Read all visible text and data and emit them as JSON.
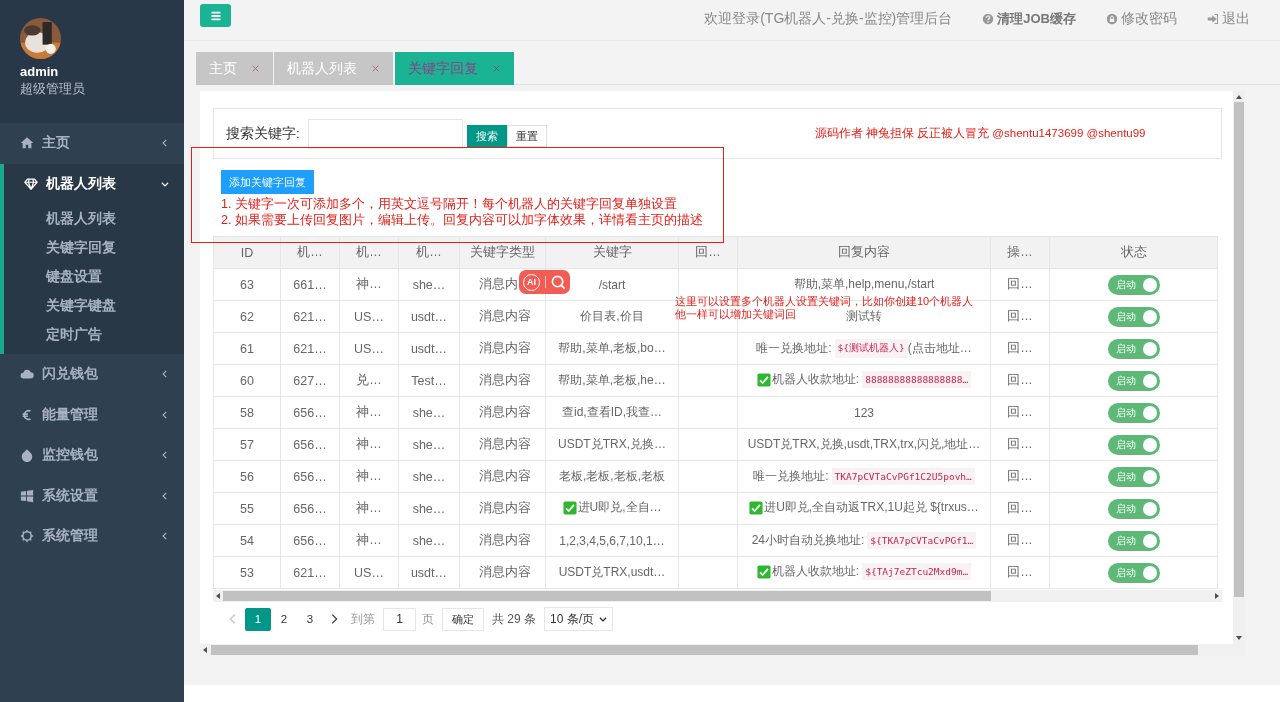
{
  "sidebar": {
    "user": {
      "name": "admin",
      "role": "超级管理员"
    },
    "menu": [
      {
        "label": "主页",
        "expanded": false
      },
      {
        "label": "机器人列表",
        "expanded": true,
        "children": [
          {
            "label": "机器人列表"
          },
          {
            "label": "关键字回复"
          },
          {
            "label": "键盘设置"
          },
          {
            "label": "关键字键盘"
          },
          {
            "label": "定时广告"
          }
        ]
      },
      {
        "label": "闪兑钱包",
        "expanded": false
      },
      {
        "label": "能量管理",
        "expanded": false
      },
      {
        "label": "监控钱包",
        "expanded": false
      },
      {
        "label": "系统设置",
        "expanded": false
      },
      {
        "label": "系统管理",
        "expanded": false
      }
    ]
  },
  "header": {
    "welcome": "欢迎登录(TG机器人-兑换-监控)管理后台",
    "actions": [
      {
        "label": "清理JOB缓存"
      },
      {
        "label": "修改密码"
      },
      {
        "label": "退出"
      }
    ]
  },
  "tabs": [
    {
      "label": "主页",
      "selected": false
    },
    {
      "label": "机器人列表",
      "selected": false
    },
    {
      "label": "关键字回复",
      "selected": true
    }
  ],
  "search": {
    "label": "搜索关键字:",
    "buttons": [
      {
        "label": "搜索",
        "kind": "primary"
      },
      {
        "label": "重置",
        "kind": "plain"
      }
    ],
    "author_note": "源码作者 神兔担保 反正被人冒充 @shentu1473699 @shentu99"
  },
  "add_button": "添加关键字回复",
  "notes": [
    "1. 关键字一次可添加多个，用英文逗号隔开！每个机器人的关键字回复单独设置",
    "2. 如果需要上传回复图片，编辑上传。回复内容可以加字体效果，详情看主页的描述"
  ],
  "table": {
    "columns": [
      "ID",
      "机…",
      "机…",
      "机…",
      "关键字类型",
      "关键字",
      "回…",
      "回复内容",
      "操…",
      "状态"
    ],
    "rows": [
      {
        "id": "63",
        "column_2": "661…",
        "column_3": "神…",
        "column_4": "she…",
        "type": "消息内",
        "keyword": [
          {
            "kind": "text",
            "text": "/start"
          }
        ],
        "reply": [
          {
            "kind": "text",
            "text": "帮助,菜单,help,menu,/start"
          }
        ],
        "column_9": "回…",
        "status": {
          "label": "启动",
          "on": true
        }
      },
      {
        "id": "62",
        "column_2": "621…",
        "column_3": "US…",
        "column_4": "usdt…",
        "type": "消息内容",
        "keyword": [
          {
            "kind": "text",
            "text": "价目表,价目"
          }
        ],
        "reply": [
          {
            "kind": "text",
            "text": "测试转"
          }
        ],
        "column_9": "回…",
        "status": {
          "label": "启动",
          "on": true
        }
      },
      {
        "id": "61",
        "column_2": "621…",
        "column_3": "US…",
        "column_4": "usdt…",
        "type": "消息内容",
        "keyword": [
          {
            "kind": "text",
            "text": "帮助,菜单,老板,bo…"
          }
        ],
        "reply": [
          {
            "kind": "text",
            "text": "唯一兑换地址: "
          },
          {
            "kind": "code",
            "text": "${测试机器人}"
          },
          {
            "kind": "text",
            "text": " (点击地址…"
          }
        ],
        "column_9": "回…",
        "status": {
          "label": "启动",
          "on": true
        }
      },
      {
        "id": "60",
        "column_2": "627…",
        "column_3": "兑…",
        "column_4": "Test…",
        "type": "消息内容",
        "keyword": [
          {
            "kind": "text",
            "text": "帮助,菜单,老板,he…"
          }
        ],
        "reply": [
          {
            "kind": "check"
          },
          {
            "kind": "text",
            "text": "机器人收款地址: "
          },
          {
            "kind": "code",
            "text": "88888888888888888…"
          }
        ],
        "column_9": "回…",
        "status": {
          "label": "启动",
          "on": true
        }
      },
      {
        "id": "58",
        "column_2": "656…",
        "column_3": "神…",
        "column_4": "she…",
        "type": "消息内容",
        "keyword": [
          {
            "kind": "text",
            "text": "查id,查看ID,我查…"
          }
        ],
        "reply": [
          {
            "kind": "text",
            "text": "123"
          }
        ],
        "column_9": "回…",
        "status": {
          "label": "启动",
          "on": true
        }
      },
      {
        "id": "57",
        "column_2": "656…",
        "column_3": "神…",
        "column_4": "she…",
        "type": "消息内容",
        "keyword": [
          {
            "kind": "text",
            "text": "USDT兑TRX,兑换…"
          }
        ],
        "reply": [
          {
            "kind": "text",
            "text": "USDT兑TRX,兑换,usdt,TRX,trx,闪兑,地址…"
          }
        ],
        "column_9": "回…",
        "status": {
          "label": "启动",
          "on": true
        }
      },
      {
        "id": "56",
        "column_2": "656…",
        "column_3": "神…",
        "column_4": "she…",
        "type": "消息内容",
        "keyword": [
          {
            "kind": "text",
            "text": "老板,老板,老板,老板"
          }
        ],
        "reply": [
          {
            "kind": "text",
            "text": "唯一兑换地址: "
          },
          {
            "kind": "code",
            "text": "TKA7pCVTaCvPGf1C2U5povh…"
          }
        ],
        "column_9": "回…",
        "status": {
          "label": "启动",
          "on": true
        }
      },
      {
        "id": "55",
        "column_2": "656…",
        "column_3": "神…",
        "column_4": "she…",
        "type": "消息内容",
        "keyword": [
          {
            "kind": "check"
          },
          {
            "kind": "text",
            "text": "进U即兑,全自…"
          }
        ],
        "reply": [
          {
            "kind": "check"
          },
          {
            "kind": "text",
            "text": "进U即兑,全自动返TRX,1U起兑 ${trxus…"
          }
        ],
        "column_9": "回…",
        "status": {
          "label": "启动",
          "on": true
        }
      },
      {
        "id": "54",
        "column_2": "656…",
        "column_3": "神…",
        "column_4": "she…",
        "type": "消息内容",
        "keyword": [
          {
            "kind": "text",
            "text": "1,2,3,4,5,6,7,10,1…"
          }
        ],
        "reply": [
          {
            "kind": "text",
            "text": "24小时自动兑换地址: "
          },
          {
            "kind": "code",
            "text": "${TKA7pCVTaCvPGf1…"
          }
        ],
        "column_9": "回…",
        "status": {
          "label": "启动",
          "on": true
        }
      },
      {
        "id": "53",
        "column_2": "621…",
        "column_3": "US…",
        "column_4": "usdt…",
        "type": "消息内容",
        "keyword": [
          {
            "kind": "text",
            "text": "USDT兑TRX,usdt…"
          }
        ],
        "reply": [
          {
            "kind": "check"
          },
          {
            "kind": "text",
            "text": "机器人收款地址: "
          },
          {
            "kind": "code",
            "text": "${TAj7eZTcu2Mxd9m…"
          }
        ],
        "column_9": "回…",
        "status": {
          "label": "启动",
          "on": true
        }
      }
    ]
  },
  "pagination": {
    "prev_disabled": true,
    "pages": [
      {
        "label": "1",
        "selected": true
      },
      {
        "label": "2",
        "selected": false
      },
      {
        "label": "3",
        "selected": false
      }
    ],
    "goto_label": "到第",
    "page_input": "1",
    "page_unit": "页",
    "confirm": "确定",
    "total": "共 29 条",
    "page_size": "10 条/页"
  },
  "overlays": {
    "annotation_note": [
      "这里可以设置多个机器人设置关键词，比如你创建10个机器人",
      "他一样可以增加关键词回"
    ],
    "ai_widget": {
      "label": "AI"
    }
  }
}
